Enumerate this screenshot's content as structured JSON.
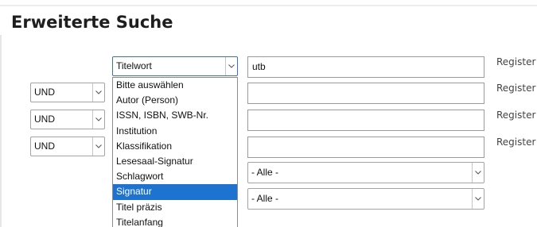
{
  "page": {
    "title": "Erweiterte Suche"
  },
  "rows": [
    {
      "operator": null,
      "field": "Titelwort",
      "term": "utb",
      "register_label": "Register"
    },
    {
      "operator": "UND",
      "field": null,
      "term": "",
      "register_label": "Register"
    },
    {
      "operator": "UND",
      "field": null,
      "term": "",
      "register_label": "Register"
    },
    {
      "operator": "UND",
      "field": null,
      "term": "",
      "register_label": "Register"
    }
  ],
  "field_dropdown": {
    "options": [
      "Bitte auswählen",
      "Autor (Person)",
      "ISSN, ISBN, SWB-Nr.",
      "Institution",
      "Klassifikation",
      "Lesesaal-Signatur",
      "Schlagwort",
      "Signatur",
      "Titel präzis",
      "Titelanfang"
    ],
    "highlighted": "Signatur"
  },
  "filters": [
    {
      "selected": "- Alle -"
    },
    {
      "selected": "- Alle -"
    }
  ],
  "colors": {
    "highlight": "#1e73d0",
    "focus_border": "#3b6cc6"
  }
}
